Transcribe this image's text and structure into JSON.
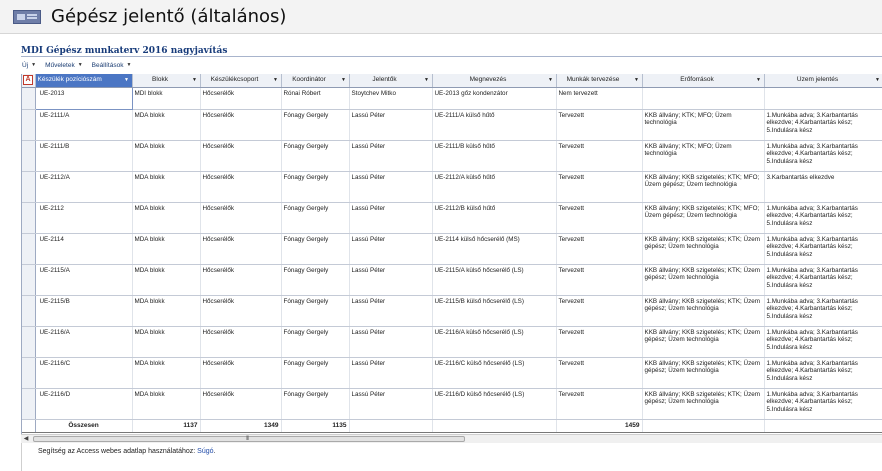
{
  "window": {
    "title": "Gépész jelentő (általános)"
  },
  "form": {
    "subtitle": "MDI Gépész munkaterv 2016 nagyjavítás"
  },
  "toolbar": {
    "new_label": "Új",
    "actions_label": "Műveletek",
    "settings_label": "Beállítások"
  },
  "grid": {
    "row_header_badge": "A",
    "columns": [
      "Készülék pozíciószám",
      "Blokk",
      "Készülékcsoport",
      "Koordinátor",
      "Jelentők",
      "Megnevezés",
      "Munkák tervezése",
      "Erőforrások",
      "Üzem jelentés"
    ],
    "rows": [
      [
        "UE-2013",
        "MDI blokk",
        "Hőcserélők",
        "Rónai Róbert",
        "Stoytchev Mitko",
        "UE-2013 gőz kondenzátor",
        "Nem tervezett",
        "",
        ""
      ],
      [
        "UE-2111/A",
        "MDA blokk",
        "Hőcserélők",
        "Fónagy Gergely",
        "Lassú Péter",
        "UE-2111/A külső hűtő",
        "Tervezett",
        "KKB állvány; KTK; MFO; Üzem technológia",
        "1.Munkába adva; 3.Karbantartás elkezdve; 4.Karbantartás kész; 5.Indulásra kész"
      ],
      [
        "UE-2111/B",
        "MDA blokk",
        "Hőcserélők",
        "Fónagy Gergely",
        "Lassú Péter",
        "UE-2111/B külső hűtő",
        "Tervezett",
        "KKB állvány; KTK; MFO; Üzem technológia",
        "1.Munkába adva; 3.Karbantartás elkezdve; 4.Karbantartás kész; 5.Indulásra kész"
      ],
      [
        "UE-2112/A",
        "MDA blokk",
        "Hőcserélők",
        "Fónagy Gergely",
        "Lassú Péter",
        "UE-2112/A külső hűtő",
        "Tervezett",
        "KKB állvány; KKB szigetelés; KTK; MFO; Üzem gépész; Üzem technológia",
        "3.Karbantartás elkezdve"
      ],
      [
        "UE-2112",
        "MDA blokk",
        "Hőcserélők",
        "Fónagy Gergely",
        "Lassú Péter",
        "UE-2112/B külső hűtő",
        "Tervezett",
        "KKB állvány; KKB szigetelés; KTK; MFO; Üzem gépész; Üzem technológia",
        "1.Munkába adva; 3.Karbantartás elkezdve; 4.Karbantartás kész; 5.Indulásra kész"
      ],
      [
        "UE-2114",
        "MDA blokk",
        "Hőcserélők",
        "Fónagy Gergely",
        "Lassú Péter",
        "UE-2114 külső hőcserélő (MS)",
        "Tervezett",
        "KKB állvány; KKB szigetelés; KTK; Üzem gépész; Üzem technológia",
        "1.Munkába adva; 3.Karbantartás elkezdve; 4.Karbantartás kész; 5.Indulásra kész"
      ],
      [
        "UE-2115/A",
        "MDA blokk",
        "Hőcserélők",
        "Fónagy Gergely",
        "Lassú Péter",
        "UE-2115/A külső hőcserélő (LS)",
        "Tervezett",
        "KKB állvány; KKB szigetelés; KTK; Üzem gépész; Üzem technológia",
        "1.Munkába adva; 3.Karbantartás elkezdve; 4.Karbantartás kész; 5.Indulásra kész"
      ],
      [
        "UE-2115/B",
        "MDA blokk",
        "Hőcserélők",
        "Fónagy Gergely",
        "Lassú Péter",
        "UE-2115/B külső hőcserélő (LS)",
        "Tervezett",
        "KKB állvány; KKB szigetelés; KTK; Üzem gépész; Üzem technológia",
        "1.Munkába adva; 3.Karbantartás elkezdve; 4.Karbantartás kész; 5.Indulásra kész"
      ],
      [
        "UE-2116/A",
        "MDA blokk",
        "Hőcserélők",
        "Fónagy Gergely",
        "Lassú Péter",
        "UE-2116/A külső hőcserélő (LS)",
        "Tervezett",
        "KKB állvány; KKB szigetelés; KTK; Üzem gépész; Üzem technológia",
        "1.Munkába adva; 3.Karbantartás elkezdve; 4.Karbantartás kész; 5.Indulásra kész"
      ],
      [
        "UE-2116/C",
        "MDA blokk",
        "Hőcserélők",
        "Fónagy Gergely",
        "Lassú Péter",
        "UE-2116/C külső hőcserélő (LS)",
        "Tervezett",
        "KKB állvány; KKB szigetelés; KTK; Üzem gépész; Üzem technológia",
        "1.Munkába adva; 3.Karbantartás elkezdve; 4.Karbantartás kész; 5.Indulásra kész"
      ],
      [
        "UE-2116/D",
        "MDA blokk",
        "Hőcserélők",
        "Fónagy Gergely",
        "Lassú Péter",
        "UE-2116/D külső hőcserélő (LS)",
        "Tervezett",
        "KKB állvány; KKB szigetelés; KTK; Üzem gépész; Üzem technológia",
        "1.Munkába adva; 3.Karbantartás elkezdve; 4.Karbantartás kész; 5.Indulásra kész"
      ]
    ],
    "totals": {
      "label": "Összesen",
      "blokk": "1137",
      "keszulekcsoport": "1349",
      "koordinator": "1135",
      "munkak": "1459"
    }
  },
  "scrollbar": {
    "grip": "III"
  },
  "footer": {
    "help_text": "Segítség az Access webes adatlap használatához: ",
    "help_link": "Súgó",
    "help_end": "."
  },
  "colors": {
    "selected_header": "#4b76c4",
    "title_text": "#173b7a",
    "link": "#1f4aa8"
  }
}
